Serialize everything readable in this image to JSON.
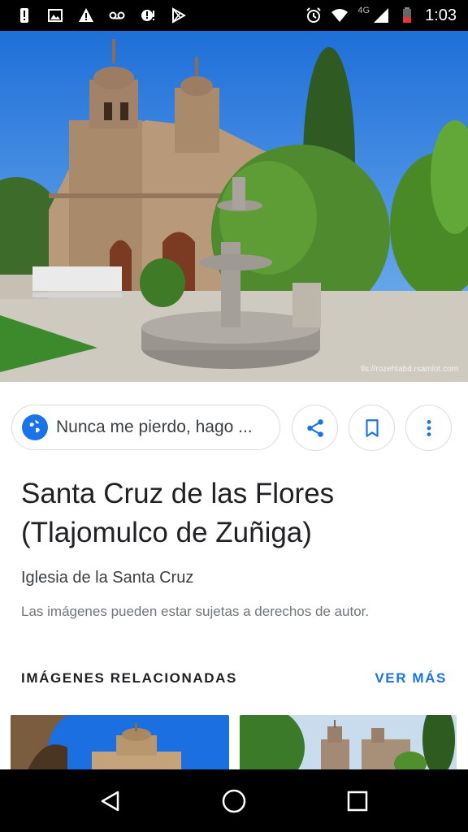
{
  "status_bar": {
    "time": "1:03",
    "network": "4G",
    "icons": [
      "alert-icon",
      "image-icon",
      "warning-icon",
      "voicemail-icon",
      "sync-alert-icon",
      "play-store-icon",
      "alarm-icon",
      "wifi-icon",
      "signal-icon",
      "battery-icon"
    ]
  },
  "hero": {
    "alt_subject": "church-with-fountain",
    "credit": "tls://rozehtabd.rsamlot.com"
  },
  "source": {
    "label": "Nunca me pierdo, hago ..."
  },
  "actions": {
    "share_icon": "share-icon",
    "save_icon": "bookmark-icon",
    "more_icon": "more-vert-icon"
  },
  "result": {
    "title": "Santa Cruz de las Flores (Tlajomulco de Zuñiga)",
    "subtitle": "Iglesia de la Santa Cruz",
    "copyright_notice": "Las imágenes pueden estar sujetas a derechos de autor."
  },
  "related": {
    "header": "IMÁGENES RELACIONADAS",
    "see_more": "VER MÁS"
  },
  "colors": {
    "accent": "#1a73e8",
    "text_primary": "#202124",
    "text_secondary": "#70757a",
    "border": "#dadce0"
  },
  "nav": {
    "back_icon": "back-icon",
    "home_icon": "home-icon",
    "recents_icon": "recents-icon"
  }
}
